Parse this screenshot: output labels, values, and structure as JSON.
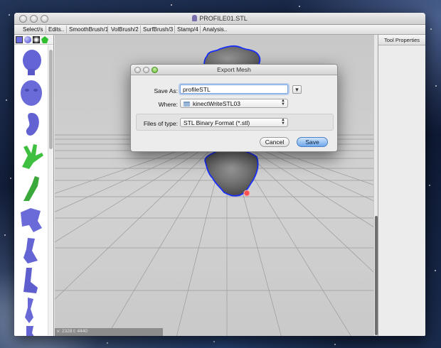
{
  "window": {
    "title": "PROFILE01.STL"
  },
  "menu": {
    "items": [
      "Select/s",
      "Edits..",
      "SmoothBrush/1",
      "VolBrush/2",
      "SurfBrush/3",
      "Stamp/4",
      "Analysis.."
    ]
  },
  "tool_panel": {
    "title": "Tool Properties"
  },
  "status": {
    "text": "v: 2328 t: 4440"
  },
  "colors": {
    "accent": "#4c7fc4",
    "selection_outline": "#1a2fff",
    "model_thumb": "#6a6ad8",
    "green_thumb": "#3fbf3f"
  },
  "palette": {
    "swatch_icons": [
      "color-swatch-icon",
      "sphere-swatch-icon",
      "material-swatch-icon",
      "green-pentagon-icon"
    ],
    "thumbnails": [
      "head-thumb",
      "face-thumb",
      "ear-thumb",
      "hand-thumb",
      "arm-thumb",
      "torso-thumb",
      "leg-thumb",
      "foot-thumb",
      "ankle-thumb",
      "pelvis-thumb"
    ]
  },
  "dialog": {
    "title": "Export Mesh",
    "save_as_label": "Save As:",
    "save_as_value": "profileSTL",
    "where_label": "Where:",
    "where_value": "kinectWriteSTL03",
    "files_of_type_label": "Files of type:",
    "files_of_type_value": "STL Binary Format (*.stl)",
    "cancel_label": "Cancel",
    "save_label": "Save",
    "expand_label": "▾"
  }
}
